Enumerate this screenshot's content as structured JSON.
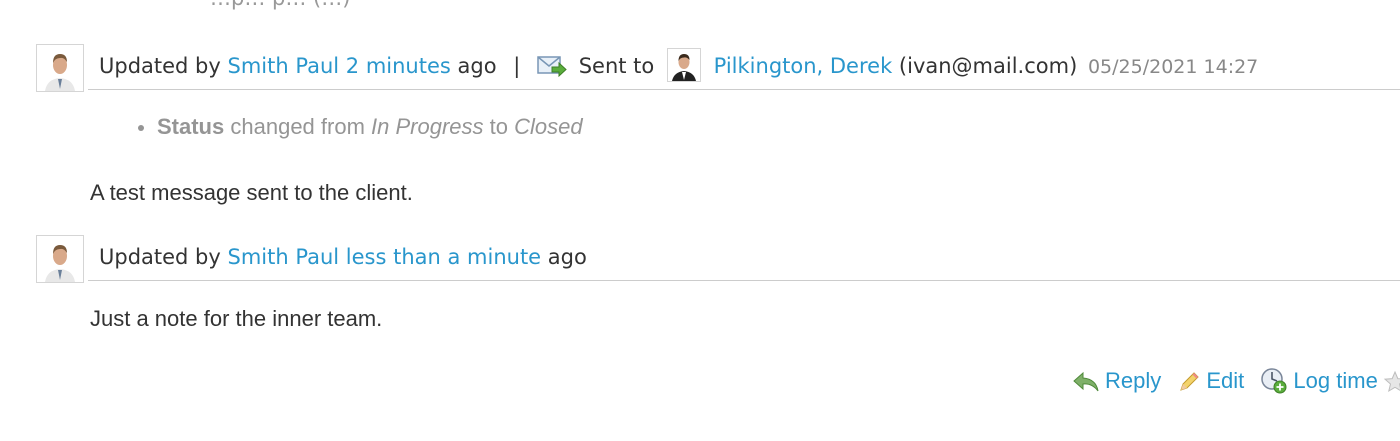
{
  "top_cut_text": "…p… p… (…)",
  "journals": [
    {
      "updated_by_prefix": "Updated by",
      "author": "Smith Paul",
      "time_ago": "2 minutes",
      "ago_suffix": "ago",
      "separator": "|",
      "sent_to_label": "Sent to",
      "recipient_name": "Pilkington, Derek",
      "recipient_email": "(ivan@mail.com)",
      "timestamp": "05/25/2021 14:27",
      "details": {
        "field": "Status",
        "changed_from": "changed from",
        "old_value": "In Progress",
        "to": "to",
        "new_value": "Closed"
      },
      "notes": "A test message sent to the client."
    },
    {
      "updated_by_prefix": "Updated by",
      "author": "Smith Paul",
      "time_ago": "less than a minute",
      "ago_suffix": "ago",
      "notes": "Just a note for the inner team."
    }
  ],
  "actions": {
    "reply": "Reply",
    "edit": "Edit",
    "log_time": "Log time"
  },
  "icons": {
    "avatar": "user-avatar-icon",
    "mail": "mail-sent-icon",
    "reply": "reply-arrow-icon",
    "edit": "pencil-icon",
    "log_time": "clock-add-icon",
    "star": "star-icon"
  },
  "colors": {
    "link": "#2996cc",
    "text": "#333333",
    "muted": "#959595",
    "border": "#cccccc"
  }
}
